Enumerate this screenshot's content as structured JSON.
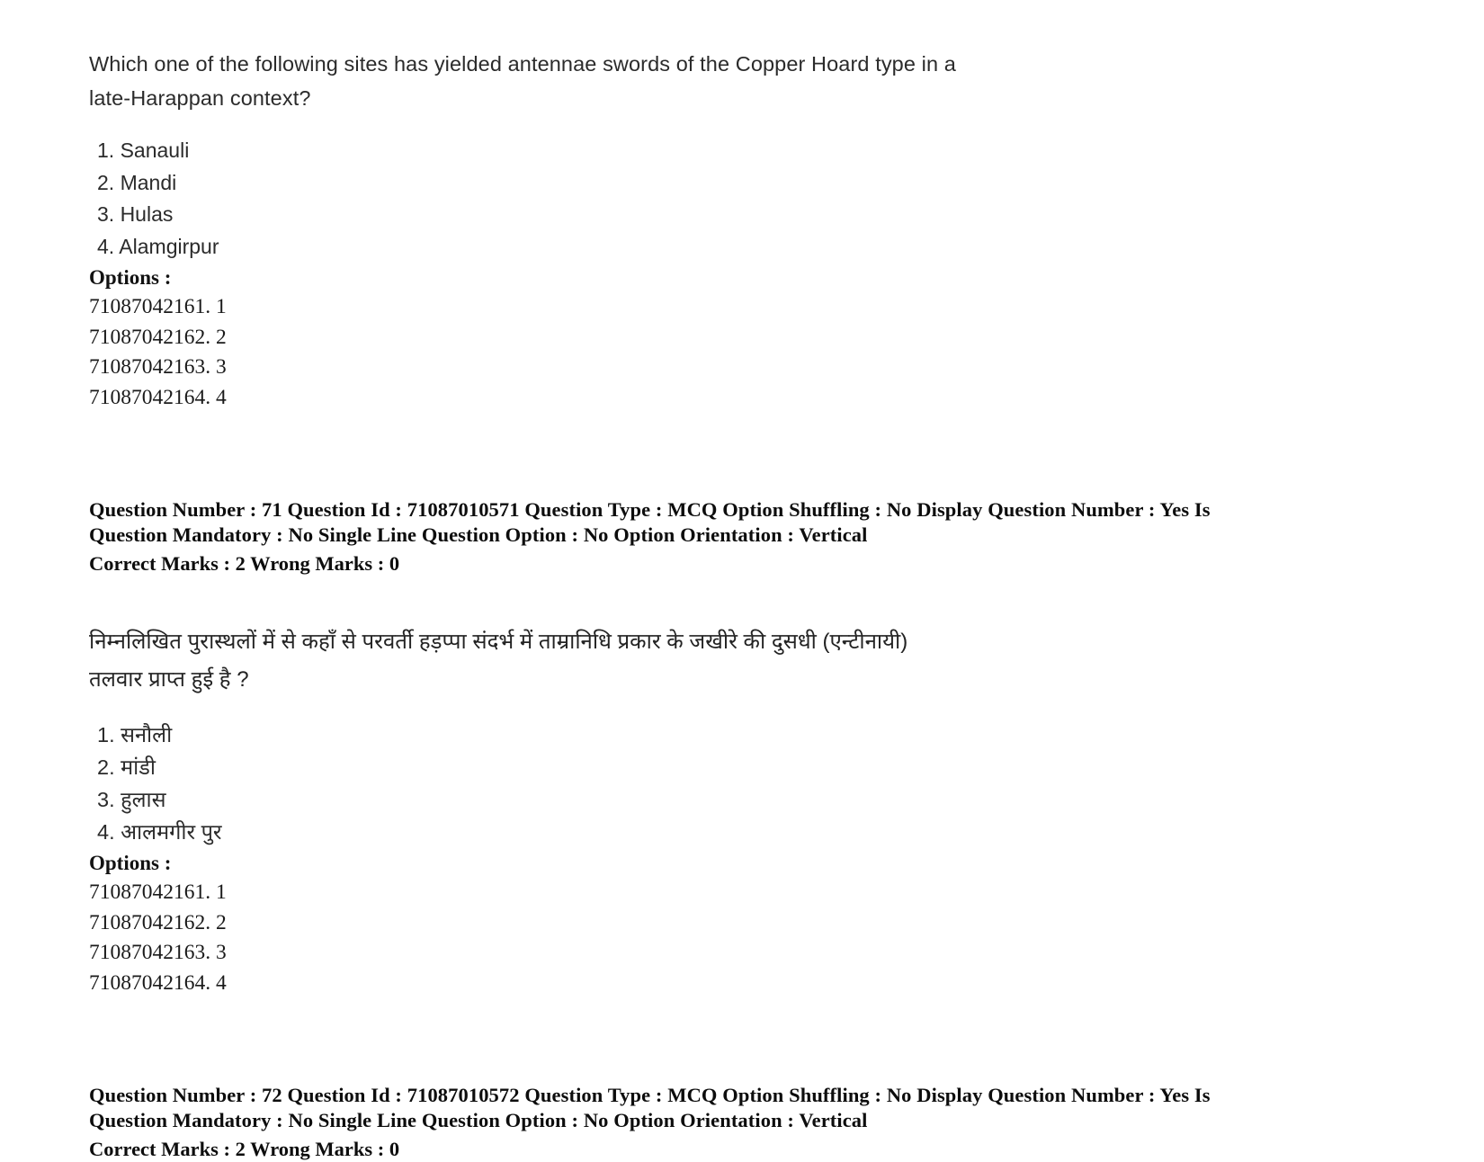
{
  "document": {
    "type": "exam-question-paper",
    "language_pair": "English / Hindi"
  },
  "questions": [
    {
      "stem_lines": [
        "Which one of the following sites has yielded antennae swords of the Copper Hoard type in a",
        "late-Harappan context?"
      ],
      "choices": [
        "1. Sanauli",
        "2. Mandi",
        "3. Hulas",
        "4. Alamgirpur"
      ],
      "options_label": "Options :",
      "option_rows": [
        "71087042161. 1",
        "71087042162. 2",
        "71087042163. 3",
        "71087042164. 4"
      ],
      "meta_lines": [
        "Question Number : 71 Question Id : 71087010571 Question Type : MCQ Option Shuffling : No Display Question Number : Yes Is",
        "Question Mandatory : No Single Line Question Option : No Option Orientation : Vertical"
      ],
      "marks_line": "Correct Marks : 2 Wrong Marks : 0"
    },
    {
      "stem_lines": [
        "निम्नलिखित पुरास्थलों में से कहाँ से परवर्ती हड़प्पा संदर्भ में ताम्रानिधि प्रकार के जखीरे की दुसधी (एन्टीनायी)",
        "तलवार प्राप्त हुई है ?"
      ],
      "choices": [
        "1. सनौली",
        "2. मांडी",
        "3. हुलास",
        "4. आलमगीर पुर"
      ],
      "options_label": "Options :",
      "option_rows": [
        "71087042161. 1",
        "71087042162. 2",
        "71087042163. 3",
        "71087042164. 4"
      ],
      "meta_lines": [
        "Question Number : 72 Question Id : 71087010572 Question Type : MCQ Option Shuffling : No Display Question Number : Yes Is",
        "Question Mandatory : No Single Line Question Option : No Option Orientation : Vertical"
      ],
      "marks_line": "Correct Marks : 2 Wrong Marks : 0"
    }
  ]
}
